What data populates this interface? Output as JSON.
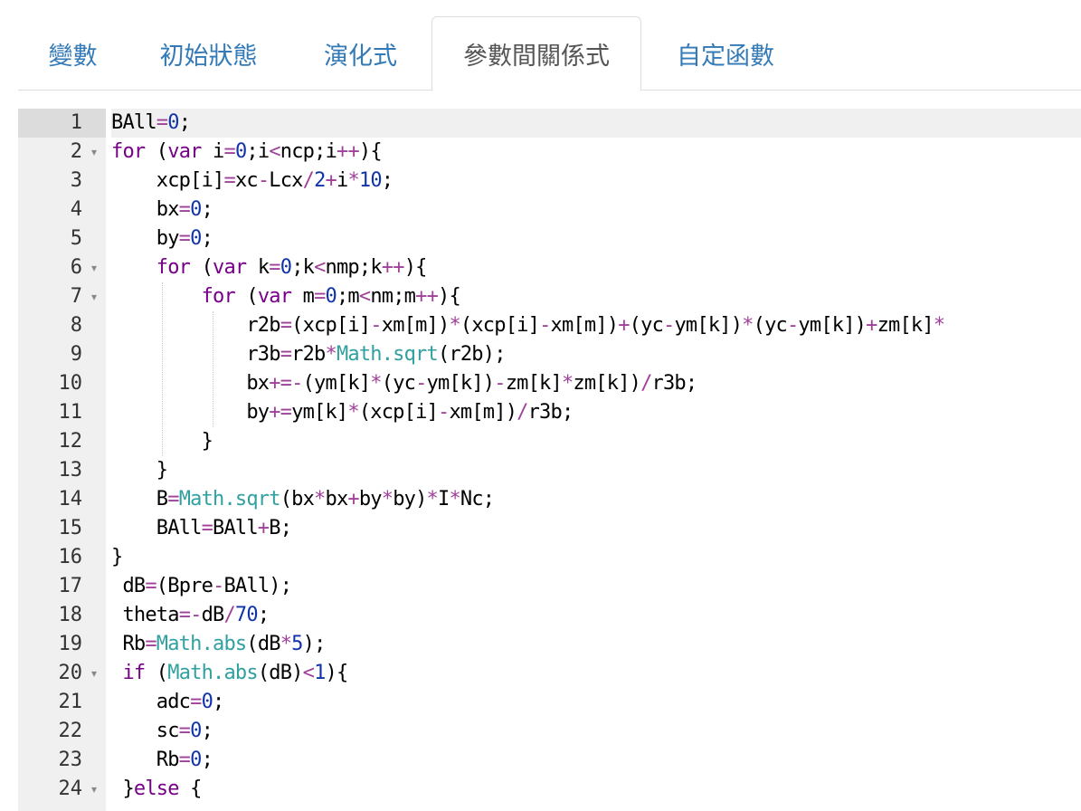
{
  "tabs": [
    {
      "label": "變數",
      "active": false
    },
    {
      "label": "初始狀態",
      "active": false
    },
    {
      "label": "演化式",
      "active": false
    },
    {
      "label": "參數間關係式",
      "active": true
    },
    {
      "label": "自定函數",
      "active": false
    }
  ],
  "colors": {
    "keyword": "#770088",
    "number": "#1133aa",
    "operator": "#a0409a",
    "builtin": "#30a0a0",
    "default": "#000000"
  },
  "editor": {
    "active_line": 1,
    "lines": [
      {
        "n": "1",
        "fold": false,
        "text": "BAll=0;"
      },
      {
        "n": "2",
        "fold": true,
        "text": "for (var i=0;i<ncp;i++){"
      },
      {
        "n": "3",
        "fold": false,
        "text": "    xcp[i]=xc-Lcx/2+i*10;"
      },
      {
        "n": "4",
        "fold": false,
        "text": "    bx=0;"
      },
      {
        "n": "5",
        "fold": false,
        "text": "    by=0;"
      },
      {
        "n": "6",
        "fold": true,
        "text": "    for (var k=0;k<nmp;k++){"
      },
      {
        "n": "7",
        "fold": true,
        "text": "        for (var m=0;m<nm;m++){"
      },
      {
        "n": "8",
        "fold": false,
        "text": "            r2b=(xcp[i]-xm[m])*(xcp[i]-xm[m])+(yc-ym[k])*(yc-ym[k])+zm[k]*"
      },
      {
        "n": "9",
        "fold": false,
        "text": "            r3b=r2b*Math.sqrt(r2b);"
      },
      {
        "n": "10",
        "fold": false,
        "text": "            bx+=-(ym[k]*(yc-ym[k])-zm[k]*zm[k])/r3b;"
      },
      {
        "n": "11",
        "fold": false,
        "text": "            by+=ym[k]*(xcp[i]-xm[m])/r3b;"
      },
      {
        "n": "12",
        "fold": false,
        "text": "        }"
      },
      {
        "n": "13",
        "fold": false,
        "text": "    }"
      },
      {
        "n": "14",
        "fold": false,
        "text": "    B=Math.sqrt(bx*bx+by*by)*I*Nc;"
      },
      {
        "n": "15",
        "fold": false,
        "text": "    BAll=BAll+B;"
      },
      {
        "n": "16",
        "fold": false,
        "text": "}"
      },
      {
        "n": "17",
        "fold": false,
        "text": " dB=(Bpre-BAll);"
      },
      {
        "n": "18",
        "fold": false,
        "text": " theta=-dB/70;"
      },
      {
        "n": "19",
        "fold": false,
        "text": " Rb=Math.abs(dB*5);"
      },
      {
        "n": "20",
        "fold": true,
        "text": " if (Math.abs(dB)<1){"
      },
      {
        "n": "21",
        "fold": false,
        "text": "    adc=0;"
      },
      {
        "n": "22",
        "fold": false,
        "text": "    sc=0;"
      },
      {
        "n": "23",
        "fold": false,
        "text": "    Rb=0;"
      },
      {
        "n": "24",
        "fold": true,
        "text": " }else {"
      }
    ]
  }
}
